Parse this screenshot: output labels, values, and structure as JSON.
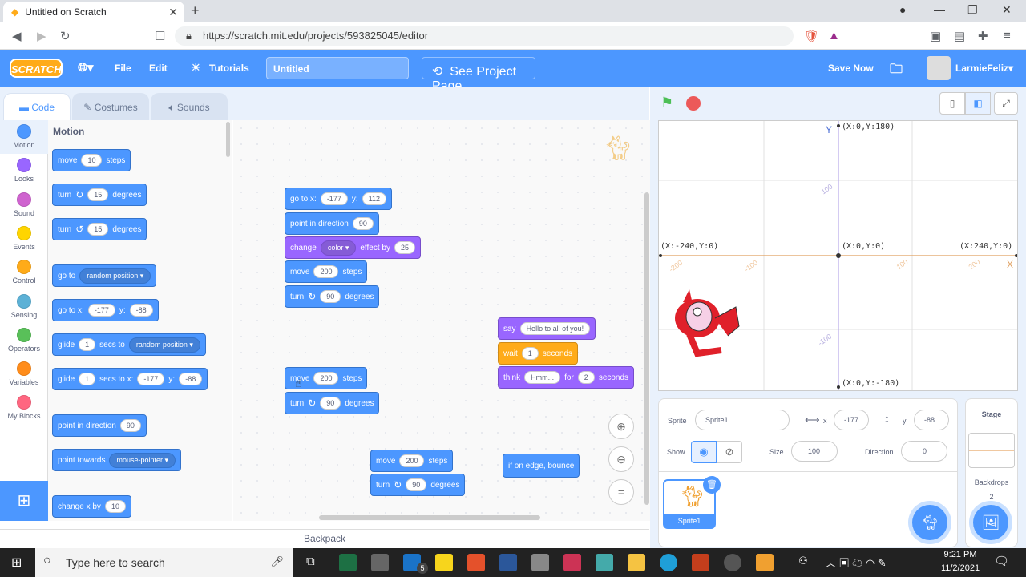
{
  "browser": {
    "tab_title": "Untitled on Scratch",
    "url": "https://scratch.mit.edu/projects/593825045/editor"
  },
  "menu": {
    "logo": "SCRATCH",
    "file": "File",
    "edit": "Edit",
    "tutorials": "Tutorials",
    "project_title": "Untitled",
    "see_project_page": "See Project Page",
    "save_now": "Save Now",
    "username": "LarmieFeliz"
  },
  "editor_tabs": {
    "code": "Code",
    "costumes": "Costumes",
    "sounds": "Sounds"
  },
  "categories": [
    {
      "label": "Motion",
      "color": "#4c97ff"
    },
    {
      "label": "Looks",
      "color": "#9966ff"
    },
    {
      "label": "Sound",
      "color": "#cf63cf"
    },
    {
      "label": "Events",
      "color": "#ffd500"
    },
    {
      "label": "Control",
      "color": "#ffab19"
    },
    {
      "label": "Sensing",
      "color": "#5cb1d6"
    },
    {
      "label": "Operators",
      "color": "#59c059"
    },
    {
      "label": "Variables",
      "color": "#ff8c1a"
    },
    {
      "label": "My Blocks",
      "color": "#ff6680"
    }
  ],
  "palette": {
    "title": "Motion",
    "move": "move",
    "steps": "steps",
    "ten": "10",
    "turn": "turn",
    "degrees": "degrees",
    "fifteen": "15",
    "go_to": "go to",
    "random_position": "random position",
    "go_to_x": "go to x:",
    "y": "y:",
    "x_val": "-177",
    "y_val": "-88",
    "glide": "glide",
    "one": "1",
    "secs_to": "secs to",
    "secs_to_x": "secs to x:",
    "point_in_direction": "point in direction",
    "ninety": "90",
    "point_towards": "point towards",
    "mouse_pointer": "mouse-pointer",
    "change_x_by": "change x by"
  },
  "workspace": {
    "go_to_x": "go to x:",
    "gx": "-177",
    "y": "y:",
    "gy": "112",
    "point_in_direction": "point in direction",
    "pdir": "90",
    "change": "change",
    "color": "color",
    "effect_by": "effect by",
    "effect_val": "25",
    "move": "move",
    "steps": "steps",
    "move_val": "200",
    "turn": "turn",
    "degrees": "degrees",
    "turn_val": "90",
    "say": "say",
    "say_text": "Hello to all of you!",
    "wait": "wait",
    "wait_val": "1",
    "seconds": "seconds",
    "think": "think",
    "think_text": "Hmm...",
    "for": "for",
    "think_secs": "2",
    "if_on_edge_bounce": "if on edge, bounce"
  },
  "backpack": "Backpack",
  "stage": {
    "y_axis": "Y",
    "x_axis": "X",
    "top": "(X:0,Y:180)",
    "bottom": "(X:0,Y:-180)",
    "left": "(X:-240,Y:0)",
    "right": "(X:240,Y:0)",
    "center": "(X:0,Y:0)",
    "t100": "100",
    "tn100": "-100",
    "l200": "-200",
    "l100": "-100",
    "r100": "100",
    "r200": "200"
  },
  "sprite_info": {
    "sprite_label": "Sprite",
    "sprite_name": "Sprite1",
    "x_label": "x",
    "x_val": "-177",
    "y_label": "y",
    "y_val": "-88",
    "show_label": "Show",
    "size_label": "Size",
    "size_val": "100",
    "direction_label": "Direction",
    "direction_val": "0",
    "thumb_name": "Sprite1"
  },
  "stage_panel": {
    "title": "Stage",
    "backdrops": "Backdrops",
    "backdrop_count": "2"
  },
  "taskbar": {
    "search": "Type here to search",
    "time": "9:21 PM",
    "date": "11/2/2021",
    "mail_badge": "5"
  }
}
